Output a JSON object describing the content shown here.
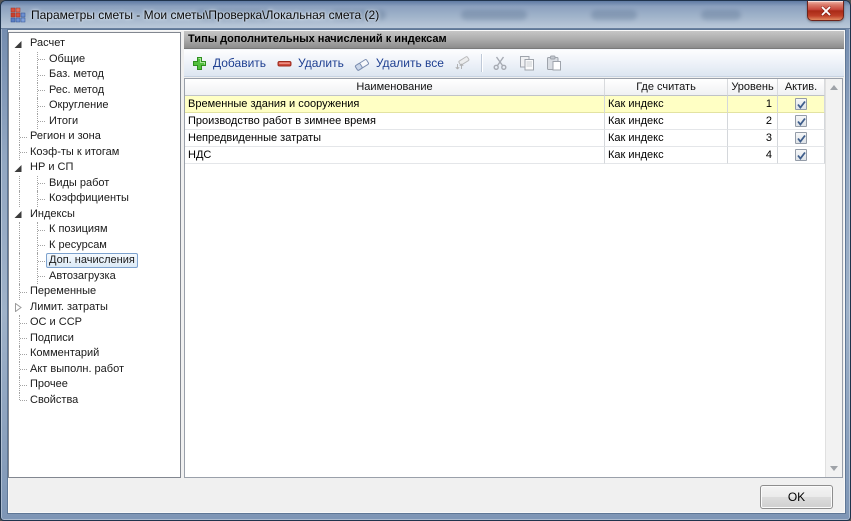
{
  "window": {
    "title": "Параметры сметы - Мои сметы\\Проверка\\Локальная смета (2)"
  },
  "colors": {
    "selected_row": "#FFFFC4",
    "toolbar_label": "#1E3F91",
    "close_button": "#C8473C",
    "tree_selection_border": "#7DA2CE",
    "dialog_background": "#F0F0F0"
  },
  "icons": {
    "app": "app-grid-icon",
    "close": "close-icon",
    "add": "plus-icon",
    "remove": "minus-icon",
    "erase_all": "eraser-icon",
    "reorder": "reorder-icon",
    "cut": "scissors-icon",
    "copy": "copy-icon",
    "paste": "paste-icon",
    "scroll_up": "scroll-up-icon",
    "scroll_down": "scroll-down-icon",
    "expanded": "tree-expanded-arrow-icon",
    "collapsed": "tree-collapsed-arrow-icon"
  },
  "tree": {
    "items": [
      {
        "label": "Расчет",
        "level": 0,
        "arrow": "expanded"
      },
      {
        "label": "Общие",
        "level": 1,
        "arrow": "none"
      },
      {
        "label": "Баз. метод",
        "level": 1,
        "arrow": "none"
      },
      {
        "label": "Рес. метод",
        "level": 1,
        "arrow": "none"
      },
      {
        "label": "Округление",
        "level": 1,
        "arrow": "none"
      },
      {
        "label": "Итоги",
        "level": 1,
        "arrow": "none"
      },
      {
        "label": "Регион и зона",
        "level": 0,
        "arrow": "none"
      },
      {
        "label": "Коэф-ты к итогам",
        "level": 0,
        "arrow": "none"
      },
      {
        "label": "НР и СП",
        "level": 0,
        "arrow": "expanded"
      },
      {
        "label": "Виды работ",
        "level": 1,
        "arrow": "none"
      },
      {
        "label": "Коэффициенты",
        "level": 1,
        "arrow": "none"
      },
      {
        "label": "Индексы",
        "level": 0,
        "arrow": "expanded"
      },
      {
        "label": "К позициям",
        "level": 1,
        "arrow": "none"
      },
      {
        "label": "К ресурсам",
        "level": 1,
        "arrow": "none"
      },
      {
        "label": "Доп. начисления",
        "level": 1,
        "arrow": "none",
        "selected": true
      },
      {
        "label": "Автозагрузка",
        "level": 1,
        "arrow": "none"
      },
      {
        "label": "Переменные",
        "level": 0,
        "arrow": "none"
      },
      {
        "label": "Лимит. затраты",
        "level": 0,
        "arrow": "collapsed"
      },
      {
        "label": "ОС и ССР",
        "level": 0,
        "arrow": "none"
      },
      {
        "label": "Подписи",
        "level": 0,
        "arrow": "none"
      },
      {
        "label": "Комментарий",
        "level": 0,
        "arrow": "none"
      },
      {
        "label": "Акт выполн. работ",
        "level": 0,
        "arrow": "none"
      },
      {
        "label": "Прочее",
        "level": 0,
        "arrow": "none"
      },
      {
        "label": "Свойства",
        "level": 0,
        "arrow": "none"
      }
    ]
  },
  "panel": {
    "caption": "Типы дополнительных начислений к индексам"
  },
  "toolbar": {
    "add_label": "Добавить",
    "delete_label": "Удалить",
    "delete_all_label": "Удалить все"
  },
  "table": {
    "columns": [
      "Наименование",
      "Где считать",
      "Уровень",
      "Актив."
    ],
    "rows": [
      {
        "name": "Временные здания и сооружения",
        "where": "Как индекс",
        "level": "1",
        "active": true,
        "selected": true
      },
      {
        "name": "Производство работ в зимнее время",
        "where": "Как индекс",
        "level": "2",
        "active": true,
        "selected": false
      },
      {
        "name": "Непредвиденные затраты",
        "where": "Как индекс",
        "level": "3",
        "active": true,
        "selected": false
      },
      {
        "name": "НДС",
        "where": "Как индекс",
        "level": "4",
        "active": true,
        "selected": false
      }
    ]
  },
  "footer": {
    "ok_label": "OK"
  }
}
